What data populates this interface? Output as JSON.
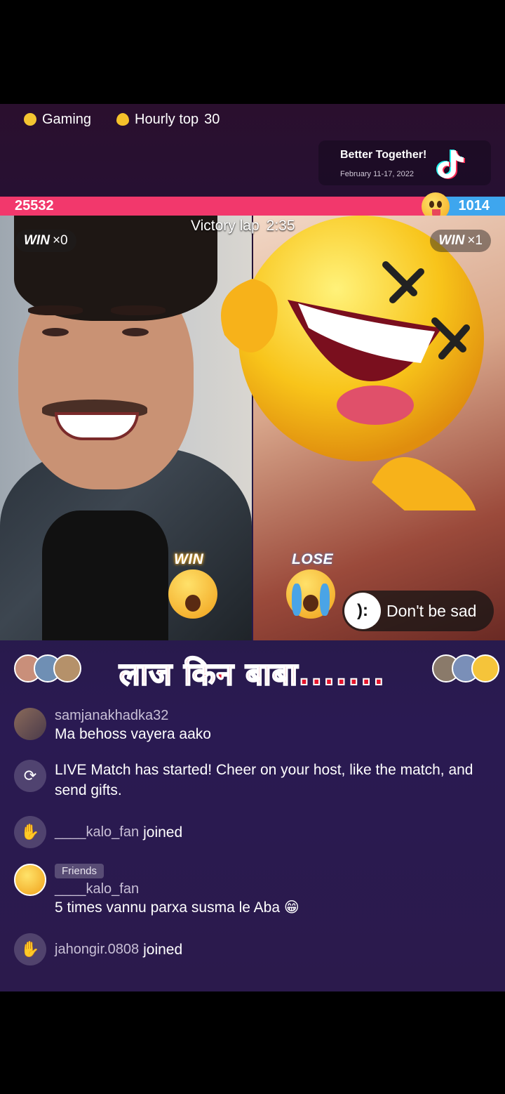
{
  "top": {
    "gaming_label": "Gaming",
    "hourly_label": "Hourly top",
    "hourly_rank": "30"
  },
  "promo": {
    "title": "Better Together!",
    "dates": "February 11-17, 2022"
  },
  "battle": {
    "left_score": "25532",
    "right_score": "1014",
    "left_share": 0.962,
    "timer_label": "Victory lap",
    "timer_value": "2:35",
    "left_win_label": "WIN",
    "left_win_count": "×0",
    "right_win_label": "WIN",
    "right_win_count": "×1",
    "left_result": "WIN",
    "right_result": "LOSE",
    "sad_icon": "):",
    "sad_label": "Don't be sad"
  },
  "overlay_caption": "लाज किन बाबा.......",
  "chat": {
    "messages": [
      {
        "user": "samjanakhadka32",
        "text": "Ma behoss vayera aako"
      },
      {
        "text": "LIVE Match has started! Cheer on your host, like the match, and send gifts."
      },
      {
        "user": "____kalo_fan",
        "text": "joined"
      },
      {
        "tag": "Friends",
        "user": "____kalo_fan",
        "text": "5 times vannu parxa susma le Aba 😁"
      },
      {
        "user": "jahongir.0808",
        "text": "joined"
      }
    ]
  },
  "colors": {
    "left_bar": "#f2386c",
    "right_bar": "#3ea6ee",
    "overlay_text": "#e3142c"
  }
}
